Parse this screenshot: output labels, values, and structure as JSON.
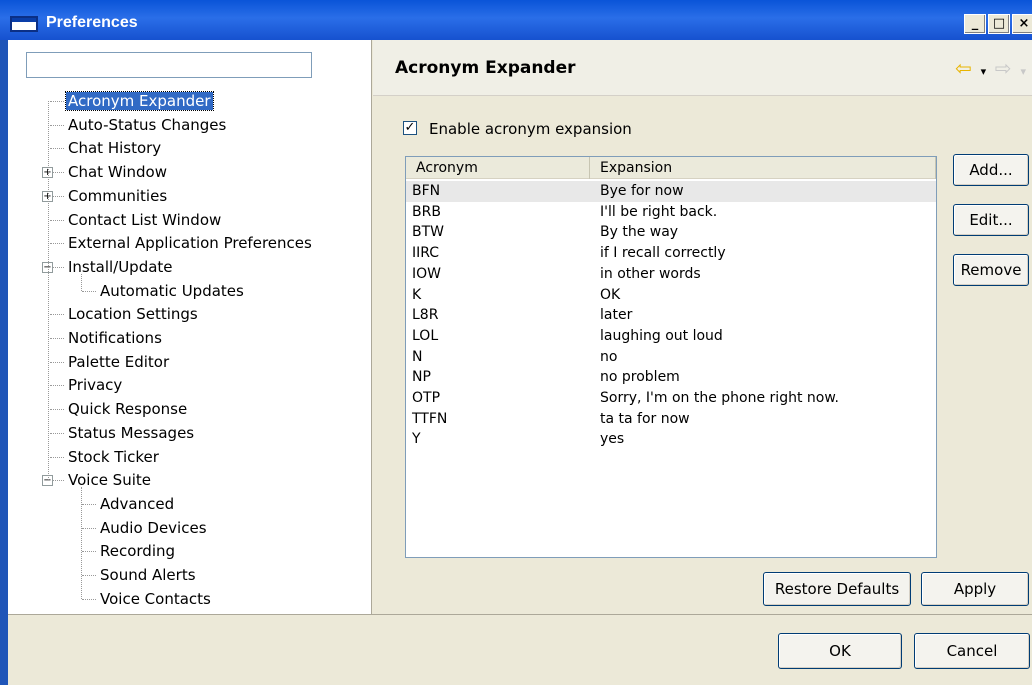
{
  "window": {
    "title": "Preferences",
    "minimize": "_",
    "maximize": "□",
    "close": "×"
  },
  "left": {
    "filter_value": "",
    "tree": [
      {
        "label": "Acronym Expander",
        "selected": true
      },
      {
        "label": "Auto-Status Changes"
      },
      {
        "label": "Chat History"
      },
      {
        "label": "Chat Window",
        "expander": "+"
      },
      {
        "label": "Communities",
        "expander": "+"
      },
      {
        "label": "Contact List Window"
      },
      {
        "label": "External Application Preferences"
      },
      {
        "label": "Install/Update",
        "expander": "−"
      },
      {
        "label": "Automatic Updates",
        "child": true
      },
      {
        "label": "Location Settings"
      },
      {
        "label": "Notifications"
      },
      {
        "label": "Palette Editor"
      },
      {
        "label": "Privacy"
      },
      {
        "label": "Quick Response"
      },
      {
        "label": "Status Messages"
      },
      {
        "label": "Stock Ticker"
      },
      {
        "label": "Voice Suite",
        "expander": "−"
      },
      {
        "label": "Advanced",
        "child": true
      },
      {
        "label": "Audio Devices",
        "child": true
      },
      {
        "label": "Recording",
        "child": true
      },
      {
        "label": "Sound Alerts",
        "child": true
      },
      {
        "label": "Voice Contacts",
        "child": true
      }
    ]
  },
  "right": {
    "page_title": "Acronym Expander",
    "enable_checkbox": {
      "checked": true,
      "label": "Enable acronym expansion"
    },
    "table": {
      "columns": [
        "Acronym",
        "Expansion"
      ],
      "rows": [
        [
          "BFN",
          "Bye for now"
        ],
        [
          "BRB",
          "I'll be right back."
        ],
        [
          "BTW",
          "By the way"
        ],
        [
          "IIRC",
          "if I recall correctly"
        ],
        [
          "IOW",
          "in other words"
        ],
        [
          "K",
          "OK"
        ],
        [
          "L8R",
          "later"
        ],
        [
          "LOL",
          "laughing out loud"
        ],
        [
          "N",
          "no"
        ],
        [
          "NP",
          "no problem"
        ],
        [
          "OTP",
          "Sorry, I'm on the phone right now."
        ],
        [
          "TTFN",
          "ta ta for now"
        ],
        [
          "Y",
          "yes"
        ]
      ]
    },
    "buttons": {
      "add": "Add...",
      "edit": "Edit...",
      "remove": "Remove",
      "restore_defaults": "Restore Defaults",
      "apply": "Apply"
    }
  },
  "footer": {
    "ok": "OK",
    "cancel": "Cancel"
  },
  "colors": {
    "titlebar": "#0a54d8",
    "selection": "#316ac5",
    "back_arrow": "#e8b400"
  }
}
